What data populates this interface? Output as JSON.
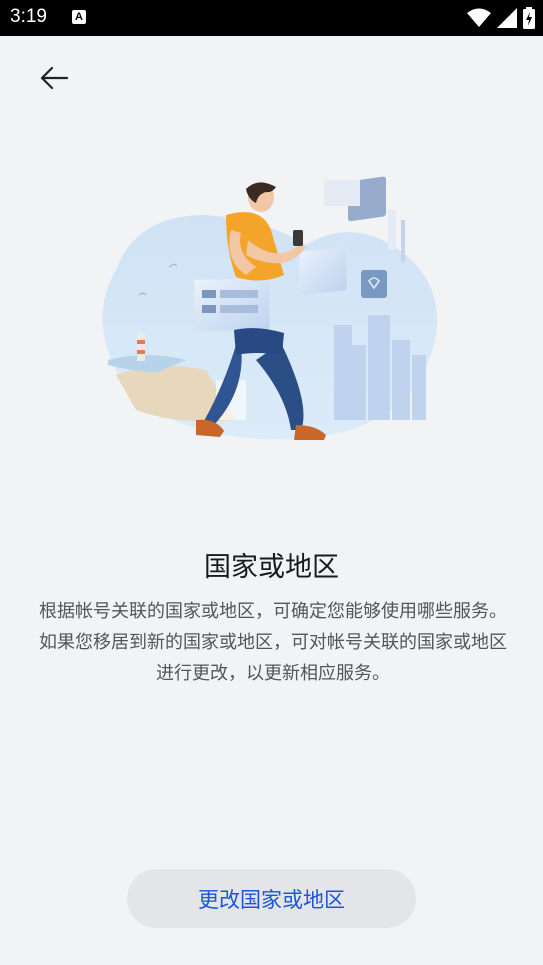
{
  "status_bar": {
    "time": "3:19",
    "notification_icon": "A",
    "icons": [
      "wifi-icon",
      "signal-icon",
      "battery-charging-icon"
    ]
  },
  "header": {
    "back_icon": "back-arrow-icon"
  },
  "main": {
    "illustration": "person-walking-with-phone-illustration",
    "title": "国家或地区",
    "description": "根据帐号关联的国家或地区，可确定您能够使用哪些服务。如果您移居到新的国家或地区，可对帐号关联的国家或地区进行更改，以更新相应服务。"
  },
  "footer": {
    "change_button_label": "更改国家或地区"
  },
  "colors": {
    "accent": "#1a56d6",
    "background": "#f1f3f5"
  }
}
